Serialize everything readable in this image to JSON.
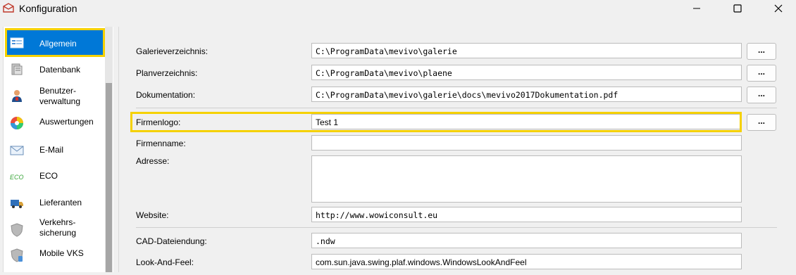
{
  "window": {
    "title": "Konfiguration",
    "minimize_icon": "minimize-icon",
    "maximize_icon": "maximize-icon",
    "close_icon": "close-icon"
  },
  "sidebar": {
    "items": [
      {
        "label": "Allgemein",
        "icon": "general-settings-icon",
        "active": true
      },
      {
        "label": "Datenbank",
        "icon": "database-icon"
      },
      {
        "label": "Benutzer-\nverwaltung",
        "icon": "user-icon"
      },
      {
        "label": "Auswertungen",
        "icon": "color-wheel-icon"
      },
      {
        "label": "E-Mail",
        "icon": "envelope-icon"
      },
      {
        "label": "ECO",
        "icon": "eco-icon"
      },
      {
        "label": "Lieferanten",
        "icon": "truck-icon"
      },
      {
        "label": "Verkehrs-\nsicherung",
        "icon": "shield-icon"
      },
      {
        "label": "Mobile VKS",
        "icon": "mobile-shield-icon"
      }
    ]
  },
  "form": {
    "galerie_label": "Galerieverzeichnis:",
    "galerie_value": "C:\\ProgramData\\mevivo\\galerie",
    "plan_label": "Planverzeichnis:",
    "plan_value": "C:\\ProgramData\\mevivo\\plaene",
    "doku_label": "Dokumentation:",
    "doku_value": "C:\\ProgramData\\mevivo\\galerie\\docs\\mevivo2017Dokumentation.pdf",
    "firmenlogo_label": "Firmenlogo:",
    "firmenlogo_value": "Test 1",
    "firmenname_label": "Firmenname:",
    "firmenname_value": "",
    "adresse_label": "Adresse:",
    "adresse_value": "",
    "website_label": "Website:",
    "website_value": "http://www.wowiconsult.eu",
    "cad_label": "CAD-Dateiendung:",
    "cad_value": ".ndw",
    "laf_label": "Look-And-Feel:",
    "laf_value": "com.sun.java.swing.plaf.windows.WindowsLookAndFeel",
    "browse_label": "..."
  },
  "colors": {
    "accent": "#0078d7",
    "highlight": "#f5d100"
  }
}
